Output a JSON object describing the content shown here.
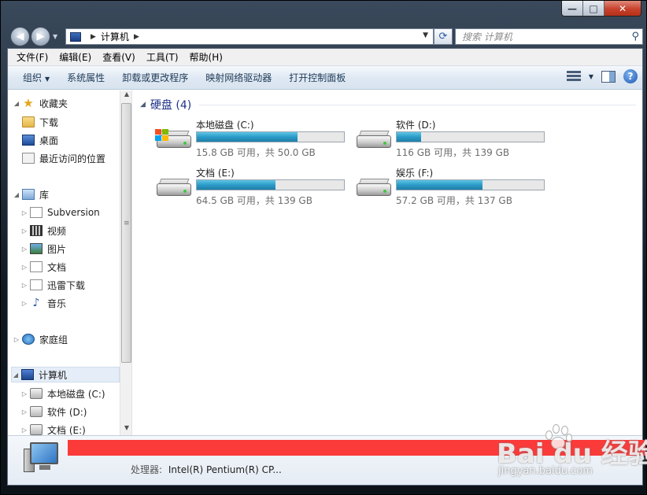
{
  "window": {
    "caption_buttons": {
      "minimize": "—",
      "maximize": "□",
      "close": "✕"
    }
  },
  "address_bar": {
    "back_icon": "back-arrow-icon",
    "forward_icon": "forward-arrow-icon",
    "breadcrumb": [
      "计算机"
    ],
    "refresh_icon": "refresh-icon",
    "search_placeholder": "搜索 计算机"
  },
  "menubar": {
    "items": [
      "文件(F)",
      "编辑(E)",
      "查看(V)",
      "工具(T)",
      "帮助(H)"
    ]
  },
  "toolbar": {
    "organize": "组织",
    "system_properties": "系统属性",
    "uninstall": "卸载或更改程序",
    "map_drive": "映射网络驱动器",
    "control_panel": "打开控制面板"
  },
  "navpane": {
    "favorites": {
      "label": "收藏夹",
      "items": [
        "下载",
        "桌面",
        "最近访问的位置"
      ]
    },
    "libraries": {
      "label": "库",
      "items": [
        "Subversion",
        "视频",
        "图片",
        "文档",
        "迅雷下载",
        "音乐"
      ]
    },
    "homegroup": {
      "label": "家庭组"
    },
    "computer": {
      "label": "计算机",
      "items": [
        "本地磁盘 (C:)",
        "软件 (D:)",
        "文档 (E:)"
      ]
    }
  },
  "main": {
    "group_title": "硬盘 (4)",
    "drives": [
      {
        "name": "本地磁盘 (C:)",
        "free_text": "15.8 GB 可用，共 50.0 GB",
        "used_fraction": 0.684,
        "system": true
      },
      {
        "name": "软件 (D:)",
        "free_text": "116 GB 可用，共 139 GB",
        "used_fraction": 0.165,
        "system": false
      },
      {
        "name": "文档 (E:)",
        "free_text": "64.5 GB 可用，共 139 GB",
        "used_fraction": 0.536,
        "system": false
      },
      {
        "name": "娱乐 (F:)",
        "free_text": "57.2 GB 可用，共 137 GB",
        "used_fraction": 0.583,
        "system": false
      }
    ]
  },
  "details": {
    "processor_label": "处理器:",
    "processor_value": "Intel(R) Pentium(R) CP..."
  },
  "watermark": {
    "logo": "Bai du 经验",
    "url": "jingyan.baidu.com"
  },
  "colors": {
    "accent": "#1e3287",
    "bar_fill": "#2b9bc7",
    "redaction": "#fb3a3a"
  }
}
